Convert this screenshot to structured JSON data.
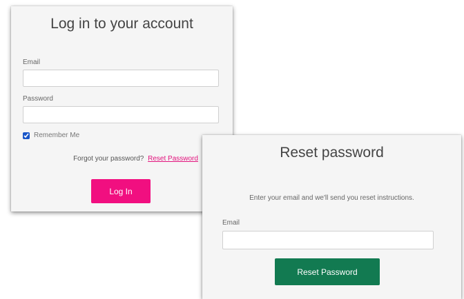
{
  "login": {
    "title": "Log in to your account",
    "email_label": "Email",
    "email_value": "",
    "password_label": "Password",
    "password_value": "",
    "remember_label": "Remember Me",
    "remember_checked": true,
    "forgot_text": "Forgot your password?",
    "forgot_link": "Reset Password",
    "login_button": "Log In"
  },
  "reset": {
    "title": "Reset password",
    "instructions": "Enter your email and we'll send you reset instructions.",
    "email_label": "Email",
    "email_value": "",
    "reset_button": "Reset Password"
  },
  "colors": {
    "card_bg": "#f5f5f5",
    "login_accent": "#f10f80",
    "reset_accent": "#127a51",
    "link": "#e2117c",
    "checkbox": "#1a56c8"
  }
}
